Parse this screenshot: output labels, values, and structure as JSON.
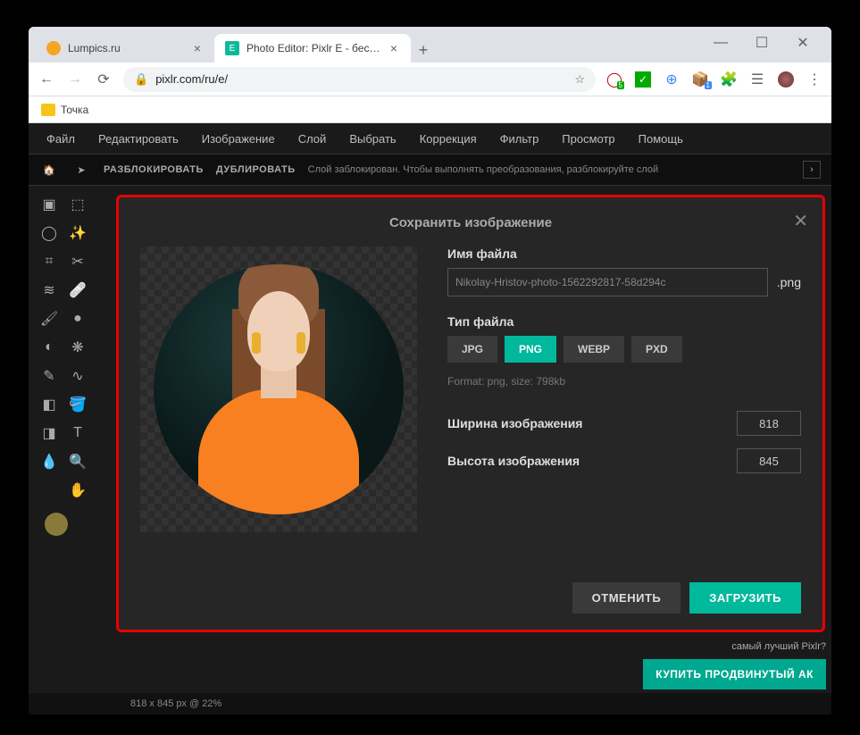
{
  "browser": {
    "tabs": [
      {
        "title": "Lumpics.ru",
        "favicon": "#f5a623",
        "active": false
      },
      {
        "title": "Photo Editor: Pixlr E - бесплатны",
        "favicon": "#0fb89c",
        "active": true
      }
    ],
    "url": "pixlr.com/ru/e/",
    "bookmark": "Точка"
  },
  "menubar": [
    "Файл",
    "Редактировать",
    "Изображение",
    "Слой",
    "Выбрать",
    "Коррекция",
    "Фильтр",
    "Просмотр",
    "Помощь"
  ],
  "toolbar": {
    "unlock": "РАЗБЛОКИРОВАТЬ",
    "duplicate": "ДУБЛИРОВАТЬ",
    "message": "Слой заблокирован. Чтобы выполнять преобразования, разблокируйте слой"
  },
  "modal": {
    "title": "Сохранить изображение",
    "filename_label": "Имя файла",
    "filename_value": "Nikolay-Hristov-photo-1562292817-58d294c",
    "extension": ".png",
    "filetype_label": "Тип файла",
    "types": [
      "JPG",
      "PNG",
      "WEBP",
      "PXD"
    ],
    "type_active": "PNG",
    "format_info": "Format: png, size: 798kb",
    "width_label": "Ширина изображения",
    "width_value": "818",
    "height_label": "Высота изображения",
    "height_value": "845",
    "cancel": "ОТМЕНИТЬ",
    "download": "ЗАГРУЗИТЬ"
  },
  "promo": {
    "text": "самый лучший Pixlr?",
    "button": "КУПИТЬ ПРОДВИНУТЫЙ АК"
  },
  "status": "818 x 845 px @ 22%"
}
